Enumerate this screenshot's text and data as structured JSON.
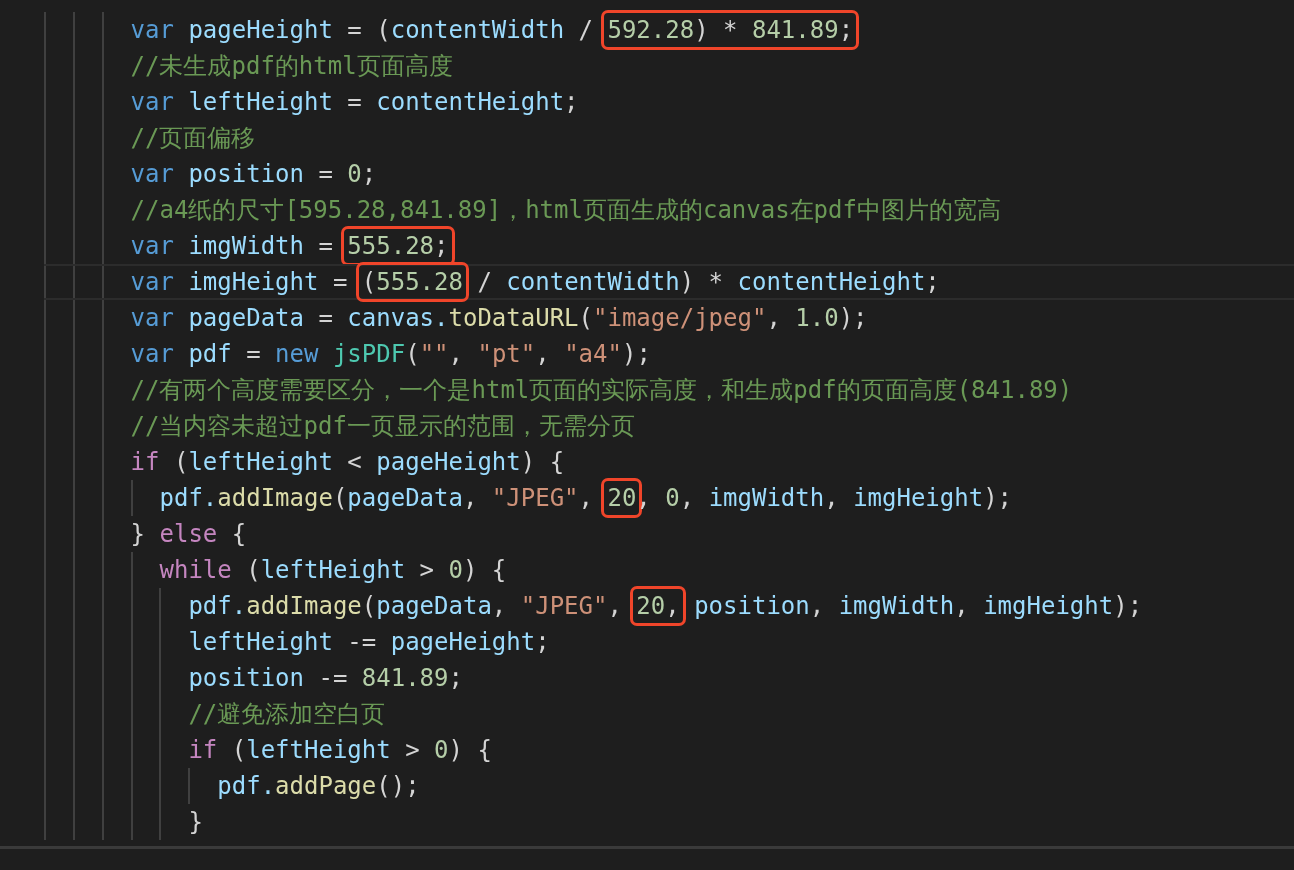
{
  "editor": {
    "lines": [
      {
        "current": false,
        "tokens": [
          {
            "text": "        var",
            "kind": "keyword"
          },
          {
            "text": " pageHeight",
            "kind": "variable"
          },
          {
            "text": " = (",
            "kind": "plain"
          },
          {
            "text": "contentWidth",
            "kind": "variable"
          },
          {
            "text": " / ",
            "kind": "plain"
          },
          {
            "kind": "annotation",
            "tokens": [
              {
                "text": "592.28",
                "kind": "number"
              },
              {
                "text": ") * ",
                "kind": "plain"
              },
              {
                "text": "841.89",
                "kind": "number"
              },
              {
                "text": ";",
                "kind": "plain"
              }
            ]
          }
        ]
      },
      {
        "current": false,
        "tokens": [
          {
            "text": "        //未生成pdf的html页面高度",
            "kind": "comment"
          }
        ]
      },
      {
        "current": false,
        "tokens": [
          {
            "text": "        var",
            "kind": "keyword"
          },
          {
            "text": " leftHeight",
            "kind": "variable"
          },
          {
            "text": " = ",
            "kind": "plain"
          },
          {
            "text": "contentHeight",
            "kind": "variable"
          },
          {
            "text": ";",
            "kind": "plain"
          }
        ]
      },
      {
        "current": false,
        "tokens": [
          {
            "text": "        //页面偏移",
            "kind": "comment"
          }
        ]
      },
      {
        "current": false,
        "tokens": [
          {
            "text": "        var",
            "kind": "keyword"
          },
          {
            "text": " position",
            "kind": "variable"
          },
          {
            "text": " = ",
            "kind": "plain"
          },
          {
            "text": "0",
            "kind": "number"
          },
          {
            "text": ";",
            "kind": "plain"
          }
        ]
      },
      {
        "current": false,
        "tokens": [
          {
            "text": "        //a4纸的尺寸[595.28,841.89]，html页面生成的canvas在pdf中图片的宽高",
            "kind": "comment"
          }
        ]
      },
      {
        "current": false,
        "tokens": [
          {
            "text": "        var",
            "kind": "keyword"
          },
          {
            "text": " imgWidth",
            "kind": "variable"
          },
          {
            "text": " = ",
            "kind": "plain"
          },
          {
            "kind": "annotation",
            "tokens": [
              {
                "text": "555.28",
                "kind": "number"
              },
              {
                "text": ";",
                "kind": "plain"
              }
            ]
          }
        ]
      },
      {
        "current": true,
        "tokens": [
          {
            "text": "        var",
            "kind": "keyword"
          },
          {
            "text": " imgHeight",
            "kind": "variable"
          },
          {
            "text": " = ",
            "kind": "plain"
          },
          {
            "kind": "annotation",
            "tokens": [
              {
                "text": "(",
                "kind": "plain"
              },
              {
                "text": "555.28",
                "kind": "number"
              }
            ]
          },
          {
            "text": " / ",
            "kind": "plain"
          },
          {
            "text": "contentWidth",
            "kind": "variable"
          },
          {
            "text": ") * ",
            "kind": "plain"
          },
          {
            "text": "contentHeight",
            "kind": "variable"
          },
          {
            "text": ";",
            "kind": "plain"
          }
        ]
      },
      {
        "current": false,
        "tokens": [
          {
            "text": "        var",
            "kind": "keyword"
          },
          {
            "text": " pageData",
            "kind": "variable"
          },
          {
            "text": " = ",
            "kind": "plain"
          },
          {
            "text": "canvas.",
            "kind": "variable"
          },
          {
            "text": "toDataURL",
            "kind": "function"
          },
          {
            "text": "(",
            "kind": "plain"
          },
          {
            "text": "\"image/jpeg\"",
            "kind": "string"
          },
          {
            "text": ", ",
            "kind": "plain"
          },
          {
            "text": "1.0",
            "kind": "number"
          },
          {
            "text": ");",
            "kind": "plain"
          }
        ]
      },
      {
        "current": false,
        "tokens": [
          {
            "text": "        var",
            "kind": "keyword"
          },
          {
            "text": " pdf",
            "kind": "variable"
          },
          {
            "text": " = ",
            "kind": "plain"
          },
          {
            "text": "new",
            "kind": "keyword"
          },
          {
            "text": " jsPDF",
            "kind": "class"
          },
          {
            "text": "(",
            "kind": "plain"
          },
          {
            "text": "\"\"",
            "kind": "string"
          },
          {
            "text": ", ",
            "kind": "plain"
          },
          {
            "text": "\"pt\"",
            "kind": "string"
          },
          {
            "text": ", ",
            "kind": "plain"
          },
          {
            "text": "\"a4\"",
            "kind": "string"
          },
          {
            "text": ");",
            "kind": "plain"
          }
        ]
      },
      {
        "current": false,
        "tokens": [
          {
            "text": "        //有两个高度需要区分，一个是html页面的实际高度，和生成pdf的页面高度(841.89)",
            "kind": "comment"
          }
        ]
      },
      {
        "current": false,
        "tokens": [
          {
            "text": "        //当内容未超过pdf一页显示的范围，无需分页",
            "kind": "comment"
          }
        ]
      },
      {
        "current": false,
        "tokens": [
          {
            "text": "        if",
            "kind": "control"
          },
          {
            "text": " (",
            "kind": "plain"
          },
          {
            "text": "leftHeight",
            "kind": "variable"
          },
          {
            "text": " < ",
            "kind": "plain"
          },
          {
            "text": "pageHeight",
            "kind": "variable"
          },
          {
            "text": ") {",
            "kind": "plain"
          }
        ]
      },
      {
        "current": false,
        "tokens": [
          {
            "text": "          pdf.",
            "kind": "variable"
          },
          {
            "text": "addImage",
            "kind": "function"
          },
          {
            "text": "(",
            "kind": "plain"
          },
          {
            "text": "pageData",
            "kind": "variable"
          },
          {
            "text": ", ",
            "kind": "plain"
          },
          {
            "text": "\"JPEG\"",
            "kind": "string"
          },
          {
            "text": ", ",
            "kind": "plain"
          },
          {
            "kind": "annotation",
            "tokens": [
              {
                "text": "20",
                "kind": "number"
              }
            ]
          },
          {
            "text": ", ",
            "kind": "plain"
          },
          {
            "text": "0",
            "kind": "number"
          },
          {
            "text": ", ",
            "kind": "plain"
          },
          {
            "text": "imgWidth",
            "kind": "variable"
          },
          {
            "text": ", ",
            "kind": "plain"
          },
          {
            "text": "imgHeight",
            "kind": "variable"
          },
          {
            "text": ");",
            "kind": "plain"
          }
        ]
      },
      {
        "current": false,
        "tokens": [
          {
            "text": "        } ",
            "kind": "plain"
          },
          {
            "text": "else",
            "kind": "control"
          },
          {
            "text": " {",
            "kind": "plain"
          }
        ]
      },
      {
        "current": false,
        "tokens": [
          {
            "text": "          while",
            "kind": "control"
          },
          {
            "text": " (",
            "kind": "plain"
          },
          {
            "text": "leftHeight",
            "kind": "variable"
          },
          {
            "text": " > ",
            "kind": "plain"
          },
          {
            "text": "0",
            "kind": "number"
          },
          {
            "text": ") {",
            "kind": "plain"
          }
        ]
      },
      {
        "current": false,
        "tokens": [
          {
            "text": "            pdf.",
            "kind": "variable"
          },
          {
            "text": "addImage",
            "kind": "function"
          },
          {
            "text": "(",
            "kind": "plain"
          },
          {
            "text": "pageData",
            "kind": "variable"
          },
          {
            "text": ", ",
            "kind": "plain"
          },
          {
            "text": "\"JPEG\"",
            "kind": "string"
          },
          {
            "text": ", ",
            "kind": "plain"
          },
          {
            "kind": "annotation",
            "tokens": [
              {
                "text": "20",
                "kind": "number"
              },
              {
                "text": ",",
                "kind": "plain"
              }
            ]
          },
          {
            "text": " position",
            "kind": "variable"
          },
          {
            "text": ", ",
            "kind": "plain"
          },
          {
            "text": "imgWidth",
            "kind": "variable"
          },
          {
            "text": ", ",
            "kind": "plain"
          },
          {
            "text": "imgHeight",
            "kind": "variable"
          },
          {
            "text": ");",
            "kind": "plain"
          }
        ]
      },
      {
        "current": false,
        "tokens": [
          {
            "text": "            leftHeight",
            "kind": "variable"
          },
          {
            "text": " -= ",
            "kind": "plain"
          },
          {
            "text": "pageHeight",
            "kind": "variable"
          },
          {
            "text": ";",
            "kind": "plain"
          }
        ]
      },
      {
        "current": false,
        "tokens": [
          {
            "text": "            position",
            "kind": "variable"
          },
          {
            "text": " -= ",
            "kind": "plain"
          },
          {
            "text": "841.89",
            "kind": "number"
          },
          {
            "text": ";",
            "kind": "plain"
          }
        ]
      },
      {
        "current": false,
        "tokens": [
          {
            "text": "            //避免添加空白页",
            "kind": "comment"
          }
        ]
      },
      {
        "current": false,
        "tokens": [
          {
            "text": "            if",
            "kind": "control"
          },
          {
            "text": " (",
            "kind": "plain"
          },
          {
            "text": "leftHeight",
            "kind": "variable"
          },
          {
            "text": " > ",
            "kind": "plain"
          },
          {
            "text": "0",
            "kind": "number"
          },
          {
            "text": ") {",
            "kind": "plain"
          }
        ]
      },
      {
        "current": false,
        "tokens": [
          {
            "text": "              pdf.",
            "kind": "variable"
          },
          {
            "text": "addPage",
            "kind": "function"
          },
          {
            "text": "();",
            "kind": "plain"
          }
        ]
      },
      {
        "current": false,
        "tokens": [
          {
            "text": "            }",
            "kind": "plain"
          }
        ]
      }
    ]
  }
}
